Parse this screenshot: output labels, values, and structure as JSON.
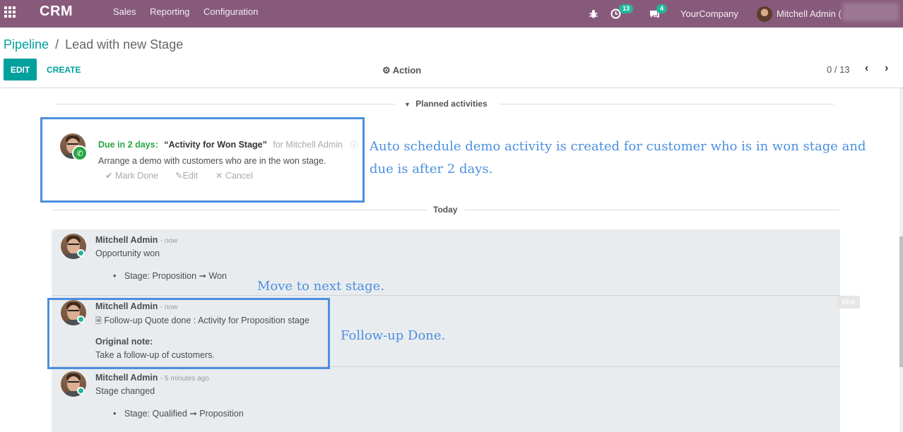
{
  "navbar": {
    "brand": "CRM",
    "menu": [
      "Sales",
      "Reporting",
      "Configuration"
    ],
    "activity_count": "13",
    "message_count": "4",
    "company": "YourCompany",
    "user": "Mitchell Admin (",
    "bg_color": "#875a7b"
  },
  "control_panel": {
    "breadcrumb_root": "Pipeline",
    "breadcrumb_sep": "/",
    "breadcrumb_current": "Lead with new Stage",
    "edit_label": "EDIT",
    "create_label": "CREATE",
    "action_label": "Action",
    "pager": "0 / 13",
    "accent_color": "#00a09d"
  },
  "planned": {
    "header": "Planned activities",
    "due": "Due in 2 days:",
    "title": "“Activity for Won Stage”",
    "assignee": "for Mitchell Admin",
    "note": "Arrange a demo with customers who are in the won stage.",
    "mark_done": "Mark Done",
    "edit": "Edit",
    "cancel": "Cancel"
  },
  "today_label": "Today",
  "messages": [
    {
      "author": "Mitchell Admin",
      "time": "- now",
      "body": "Opportunity won",
      "tracking_from": "Stage: Proposition",
      "tracking_to": "Won"
    },
    {
      "author": "Mitchell Admin",
      "time": "- now",
      "body": "Follow-up Quote done : Activity for Proposition stage",
      "note_label": "Original note:",
      "note": "Take a follow-up of customers."
    },
    {
      "author": "Mitchell Admin",
      "time": "- 5 minutes ago",
      "body": "Stage changed",
      "tracking_from": "Stage: Qualified",
      "tracking_to": "Proposition"
    }
  ],
  "annotations": {
    "auto_schedule": "Auto schedule demo activity is created for customer who is in won stage and due is after 2 days.",
    "next_stage": "Move to next stage.",
    "followup_done": "Follow-up Done.",
    "color": "#4c8fe0"
  },
  "blur_tag": "Blur"
}
